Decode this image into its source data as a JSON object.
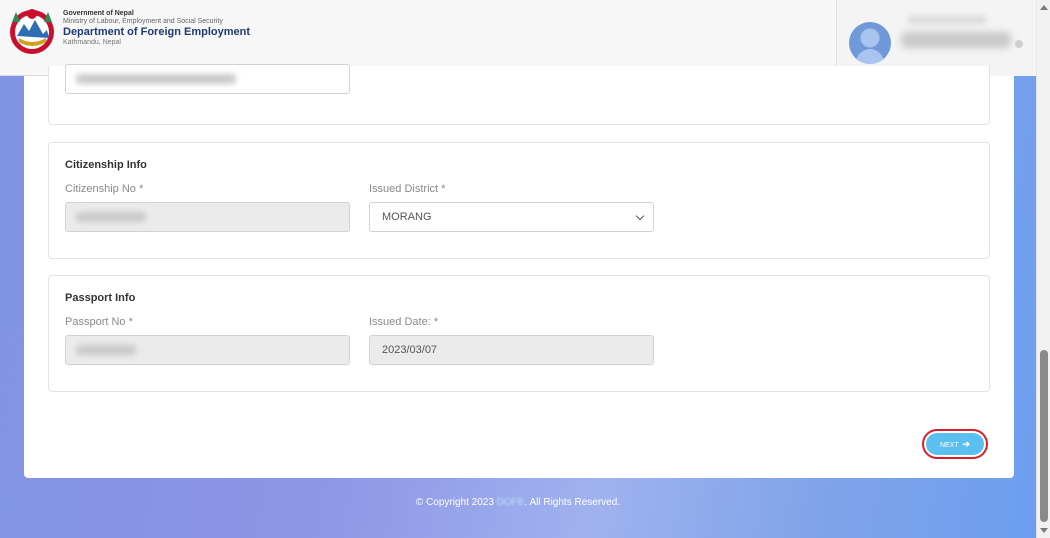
{
  "header": {
    "org_line1": "Government of Nepal",
    "org_line2": "Ministry of Labour, Employment and Social Security",
    "org_line3": "Department of Foreign Employment",
    "org_line4": "Kathmandu, Nepal"
  },
  "citizenship": {
    "title": "Citizenship Info",
    "no_label": "Citizenship No *",
    "district_label": "Issued District *",
    "district_value": "MORANG"
  },
  "passport": {
    "title": "Passport Info",
    "no_label": "Passport No *",
    "date_label": "Issued Date: *",
    "date_value": "2023/03/07"
  },
  "actions": {
    "next_label": "NEXT",
    "next_arrow": "➔"
  },
  "footer": {
    "prefix": "© Copyright 2023 ",
    "brand": "DOFE",
    "suffix": ". All Rights Reserved."
  },
  "colors": {
    "accent": "#5bc0f0",
    "highlight": "#d81f2a",
    "brand_text": "#1f3b73"
  },
  "icons": {
    "logo": "nepal-emblem-icon",
    "avatar": "user-avatar-icon",
    "dropdown": "chevron-down-icon",
    "next": "arrow-right-icon"
  }
}
